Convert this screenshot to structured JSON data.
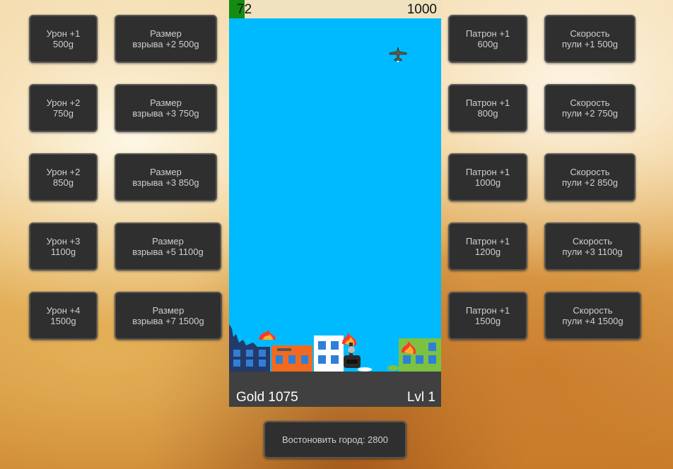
{
  "left_col1": [
    {
      "line1": "Урон +1",
      "line2": "500g"
    },
    {
      "line1": "Урон +2",
      "line2": "750g"
    },
    {
      "line1": "Урон +2",
      "line2": "850g"
    },
    {
      "line1": "Урон +3",
      "line2": "1100g"
    },
    {
      "line1": "Урон +4",
      "line2": "1500g"
    }
  ],
  "left_col2": [
    {
      "line1": "Размер",
      "line2": "взрыва +2 500g"
    },
    {
      "line1": "Размер",
      "line2": "взрыва +3 750g"
    },
    {
      "line1": "Размер",
      "line2": "взрыва +3 850g"
    },
    {
      "line1": "Размер",
      "line2": "взрыва +5 1100g"
    },
    {
      "line1": "Размер",
      "line2": "взрыва +7 1500g"
    }
  ],
  "right_col1": [
    {
      "line1": "Патрон +1",
      "line2": "600g"
    },
    {
      "line1": "Патрон +1",
      "line2": "800g"
    },
    {
      "line1": "Патрон +1",
      "line2": "1000g"
    },
    {
      "line1": "Патрон +1",
      "line2": "1200g"
    },
    {
      "line1": "Патрон +1",
      "line2": "1500g"
    }
  ],
  "right_col2": [
    {
      "line1": "Скорость",
      "line2": "пули +1 500g"
    },
    {
      "line1": "Скорость",
      "line2": "пули +2 750g"
    },
    {
      "line1": "Скорость",
      "line2": "пули +2 850g"
    },
    {
      "line1": "Скорость",
      "line2": "пули +3 1100g"
    },
    {
      "line1": "Скорость",
      "line2": "пули +4 1500g"
    }
  ],
  "game": {
    "health": "72",
    "score": "1000",
    "gold": "Gold 1075",
    "level": "Lvl 1",
    "colors": {
      "sky": "#00baff",
      "health_bar": "#128c12",
      "ground": "#404040"
    }
  },
  "restore_button": "Востоновить город: 2800"
}
